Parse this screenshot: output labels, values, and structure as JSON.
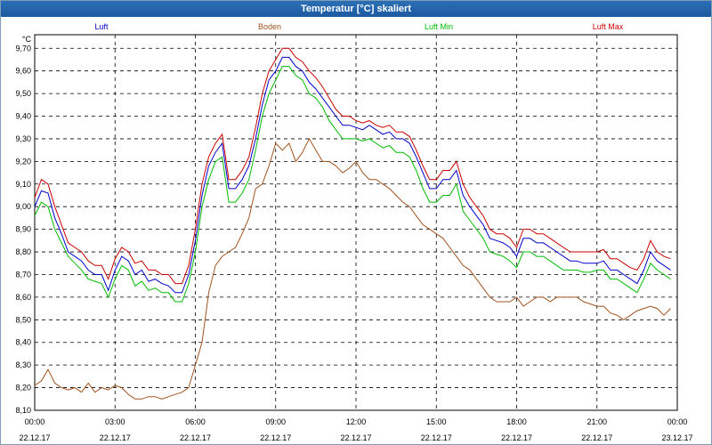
{
  "chart_data": {
    "type": "line",
    "title": "Temperatur [°C] skaliert",
    "ylabel": "°C",
    "ylim": [
      8.1,
      9.76
    ],
    "yticks": [
      "8,10",
      "8,20",
      "8,30",
      "8,40",
      "8,50",
      "8,60",
      "8,70",
      "8,80",
      "8,90",
      "9,00",
      "9,10",
      "9,20",
      "9,30",
      "9,40",
      "9,50",
      "9,60",
      "9,70"
    ],
    "xticks": [
      {
        "time": "00:00",
        "date": "22.12.17"
      },
      {
        "time": "03:00",
        "date": "22.12.17"
      },
      {
        "time": "06:00",
        "date": "22.12.17"
      },
      {
        "time": "09:00",
        "date": "22.12.17"
      },
      {
        "time": "12:00",
        "date": "22.12.17"
      },
      {
        "time": "15:00",
        "date": "22.12.17"
      },
      {
        "time": "18:00",
        "date": "22.12.17"
      },
      {
        "time": "21:00",
        "date": "22.12.17"
      },
      {
        "time": "00:00",
        "date": "23.12.17"
      }
    ],
    "x_hours": [
      0,
      0.25,
      0.5,
      0.75,
      1,
      1.25,
      1.5,
      1.75,
      2,
      2.25,
      2.5,
      2.75,
      3,
      3.25,
      3.5,
      3.75,
      4,
      4.25,
      4.5,
      4.75,
      5,
      5.25,
      5.5,
      5.75,
      6,
      6.25,
      6.5,
      6.75,
      7,
      7.25,
      7.5,
      7.75,
      8,
      8.25,
      8.5,
      8.75,
      9,
      9.25,
      9.5,
      9.75,
      10,
      10.25,
      10.5,
      10.75,
      11,
      11.25,
      11.5,
      11.75,
      12,
      12.25,
      12.5,
      12.75,
      13,
      13.25,
      13.5,
      13.75,
      14,
      14.25,
      14.5,
      14.75,
      15,
      15.25,
      15.5,
      15.75,
      16,
      16.25,
      16.5,
      16.75,
      17,
      17.25,
      17.5,
      17.75,
      18,
      18.25,
      18.5,
      18.75,
      19,
      19.25,
      19.5,
      19.75,
      20,
      20.25,
      20.5,
      20.75,
      21,
      21.25,
      21.5,
      21.75,
      22,
      22.25,
      22.5,
      22.75,
      23,
      23.25,
      23.5,
      23.75
    ],
    "series": [
      {
        "name": "Luft",
        "color": "#0000cc",
        "values": [
          9.0,
          9.07,
          9.06,
          8.95,
          8.88,
          8.8,
          8.78,
          8.76,
          8.72,
          8.7,
          8.7,
          8.63,
          8.72,
          8.78,
          8.76,
          8.7,
          8.72,
          8.67,
          8.68,
          8.66,
          8.65,
          8.62,
          8.62,
          8.7,
          8.85,
          9.05,
          9.18,
          9.24,
          9.28,
          9.08,
          9.08,
          9.12,
          9.18,
          9.3,
          9.45,
          9.56,
          9.6,
          9.66,
          9.66,
          9.62,
          9.6,
          9.55,
          9.52,
          9.48,
          9.44,
          9.4,
          9.36,
          9.36,
          9.35,
          9.34,
          9.36,
          9.34,
          9.32,
          9.33,
          9.3,
          9.3,
          9.28,
          9.22,
          9.15,
          9.08,
          9.08,
          9.12,
          9.12,
          9.16,
          9.05,
          9.0,
          8.96,
          8.92,
          8.86,
          8.85,
          8.84,
          8.82,
          8.78,
          8.86,
          8.86,
          8.84,
          8.84,
          8.82,
          8.8,
          8.78,
          8.76,
          8.76,
          8.75,
          8.75,
          8.75,
          8.76,
          8.72,
          8.72,
          8.7,
          8.68,
          8.66,
          8.72,
          8.8,
          8.76,
          8.74,
          8.72
        ]
      },
      {
        "name": "Boden",
        "color": "#a0521e",
        "values": [
          8.21,
          8.23,
          8.28,
          8.22,
          8.2,
          8.19,
          8.2,
          8.18,
          8.22,
          8.18,
          8.2,
          8.19,
          8.21,
          8.2,
          8.17,
          8.15,
          8.15,
          8.16,
          8.16,
          8.15,
          8.16,
          8.17,
          8.18,
          8.2,
          8.3,
          8.4,
          8.62,
          8.74,
          8.78,
          8.8,
          8.82,
          8.88,
          8.95,
          9.08,
          9.1,
          9.18,
          9.28,
          9.25,
          9.28,
          9.2,
          9.24,
          9.3,
          9.25,
          9.2,
          9.2,
          9.18,
          9.15,
          9.17,
          9.2,
          9.15,
          9.12,
          9.12,
          9.1,
          9.08,
          9.05,
          9.02,
          9.0,
          8.96,
          8.92,
          8.9,
          8.88,
          8.86,
          8.82,
          8.78,
          8.74,
          8.72,
          8.68,
          8.64,
          8.6,
          8.58,
          8.58,
          8.58,
          8.6,
          8.56,
          8.58,
          8.6,
          8.6,
          8.58,
          8.6,
          8.6,
          8.6,
          8.6,
          8.58,
          8.57,
          8.56,
          8.56,
          8.53,
          8.52,
          8.5,
          8.52,
          8.54,
          8.55,
          8.56,
          8.55,
          8.52,
          8.55
        ]
      },
      {
        "name": "Luft Min",
        "color": "#00bb00",
        "values": [
          8.96,
          9.02,
          9.0,
          8.9,
          8.84,
          8.78,
          8.75,
          8.72,
          8.68,
          8.67,
          8.66,
          8.6,
          8.68,
          8.74,
          8.72,
          8.65,
          8.67,
          8.63,
          8.64,
          8.62,
          8.62,
          8.58,
          8.58,
          8.66,
          8.8,
          9.0,
          9.12,
          9.2,
          9.22,
          9.02,
          9.02,
          9.06,
          9.12,
          9.25,
          9.4,
          9.5,
          9.56,
          9.62,
          9.62,
          9.58,
          9.56,
          9.5,
          9.48,
          9.44,
          9.38,
          9.34,
          9.3,
          9.3,
          9.3,
          9.29,
          9.3,
          9.28,
          9.26,
          9.27,
          9.24,
          9.24,
          9.22,
          9.16,
          9.08,
          9.02,
          9.02,
          9.05,
          9.05,
          9.1,
          8.98,
          8.94,
          8.9,
          8.86,
          8.8,
          8.79,
          8.78,
          8.76,
          8.73,
          8.8,
          8.8,
          8.78,
          8.78,
          8.76,
          8.74,
          8.72,
          8.72,
          8.72,
          8.71,
          8.71,
          8.72,
          8.72,
          8.68,
          8.68,
          8.66,
          8.64,
          8.62,
          8.68,
          8.75,
          8.72,
          8.7,
          8.68
        ]
      },
      {
        "name": "Luft Max",
        "color": "#cc0000",
        "values": [
          9.04,
          9.12,
          9.1,
          9.0,
          8.92,
          8.84,
          8.82,
          8.8,
          8.76,
          8.74,
          8.74,
          8.68,
          8.77,
          8.82,
          8.8,
          8.75,
          8.76,
          8.72,
          8.72,
          8.7,
          8.7,
          8.66,
          8.66,
          8.74,
          8.9,
          9.1,
          9.22,
          9.28,
          9.32,
          9.12,
          9.12,
          9.16,
          9.22,
          9.35,
          9.5,
          9.6,
          9.65,
          9.7,
          9.7,
          9.66,
          9.64,
          9.6,
          9.57,
          9.53,
          9.48,
          9.43,
          9.4,
          9.4,
          9.38,
          9.37,
          9.38,
          9.36,
          9.35,
          9.36,
          9.33,
          9.33,
          9.31,
          9.25,
          9.18,
          9.12,
          9.12,
          9.16,
          9.16,
          9.2,
          9.1,
          9.04,
          9.0,
          8.96,
          8.9,
          8.88,
          8.88,
          8.86,
          8.82,
          8.9,
          8.9,
          8.88,
          8.88,
          8.86,
          8.84,
          8.82,
          8.8,
          8.8,
          8.8,
          8.8,
          8.8,
          8.81,
          8.77,
          8.77,
          8.75,
          8.73,
          8.72,
          8.77,
          8.85,
          8.8,
          8.78,
          8.77
        ]
      }
    ],
    "grid": true,
    "legend_position": "top"
  }
}
